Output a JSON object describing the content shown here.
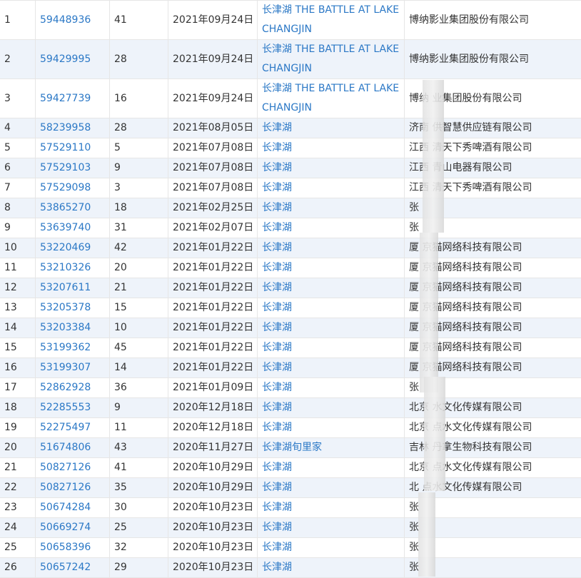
{
  "table": {
    "rows": [
      {
        "idx": "1",
        "reg": "59448936",
        "cls": "41",
        "date": "2021年09月24日",
        "name": "长津湖 THE BATTLE AT LAKE CHANGJIN",
        "owner": "博纳影业集团股份有限公司"
      },
      {
        "idx": "2",
        "reg": "59429995",
        "cls": "28",
        "date": "2021年09月24日",
        "name": "长津湖 THE BATTLE AT LAKE CHANGJIN",
        "owner": "博纳影业集团股份有限公司"
      },
      {
        "idx": "3",
        "reg": "59427739",
        "cls": "16",
        "date": "2021年09月24日",
        "name": "长津湖 THE BATTLE AT LAKE CHANGJIN",
        "owner": "博纳  业集团股份有限公司"
      },
      {
        "idx": "4",
        "reg": "58239958",
        "cls": "28",
        "date": "2021年08月05日",
        "name": "长津湖",
        "owner": "济南  供智慧供应链有限公司"
      },
      {
        "idx": "5",
        "reg": "57529110",
        "cls": "5",
        "date": "2021年07月08日",
        "name": "长津湖",
        "owner": "江西  清天下秀啤酒有限公司"
      },
      {
        "idx": "6",
        "reg": "57529103",
        "cls": "9",
        "date": "2021年07月08日",
        "name": "长津湖",
        "owner": "江西  青山电器有限公司"
      },
      {
        "idx": "7",
        "reg": "57529098",
        "cls": "3",
        "date": "2021年07月08日",
        "name": "长津湖",
        "owner": "江西  清天下秀啤酒有限公司"
      },
      {
        "idx": "8",
        "reg": "53865270",
        "cls": "18",
        "date": "2021年02月25日",
        "name": "长津湖",
        "owner": "张"
      },
      {
        "idx": "9",
        "reg": "53639740",
        "cls": "31",
        "date": "2021年02月07日",
        "name": "长津湖",
        "owner": "张"
      },
      {
        "idx": "10",
        "reg": "53220469",
        "cls": "42",
        "date": "2021年01月22日",
        "name": "长津湖",
        "owner": "厦  京猫网络科技有限公司"
      },
      {
        "idx": "11",
        "reg": "53210326",
        "cls": "20",
        "date": "2021年01月22日",
        "name": "长津湖",
        "owner": "厦  京猫网络科技有限公司"
      },
      {
        "idx": "12",
        "reg": "53207611",
        "cls": "21",
        "date": "2021年01月22日",
        "name": "长津湖",
        "owner": "厦  京猫网络科技有限公司"
      },
      {
        "idx": "13",
        "reg": "53205378",
        "cls": "15",
        "date": "2021年01月22日",
        "name": "长津湖",
        "owner": "厦  京猫网络科技有限公司"
      },
      {
        "idx": "14",
        "reg": "53203384",
        "cls": "10",
        "date": "2021年01月22日",
        "name": "长津湖",
        "owner": "厦  京猫网络科技有限公司"
      },
      {
        "idx": "15",
        "reg": "53199362",
        "cls": "45",
        "date": "2021年01月22日",
        "name": "长津湖",
        "owner": "厦  京猫网络科技有限公司"
      },
      {
        "idx": "16",
        "reg": "53199307",
        "cls": "14",
        "date": "2021年01月22日",
        "name": "长津湖",
        "owner": "厦  京猫网络科技有限公司"
      },
      {
        "idx": "17",
        "reg": "52862928",
        "cls": "36",
        "date": "2021年01月09日",
        "name": "长津湖",
        "owner": "张"
      },
      {
        "idx": "18",
        "reg": "52285553",
        "cls": "9",
        "date": "2020年12月18日",
        "name": "长津湖",
        "owner": "北京  水文化传媒有限公司"
      },
      {
        "idx": "19",
        "reg": "52275497",
        "cls": "11",
        "date": "2020年12月18日",
        "name": "长津湖",
        "owner": "北京  点水文化传媒有限公司"
      },
      {
        "idx": "20",
        "reg": "51674806",
        "cls": "43",
        "date": "2020年11月27日",
        "name": "长津湖旬里家",
        "owner": "吉林  丹拿生物科技有限公司"
      },
      {
        "idx": "21",
        "reg": "50827126",
        "cls": "41",
        "date": "2020年10月29日",
        "name": "长津湖",
        "owner": "北京  点水文化传媒有限公司"
      },
      {
        "idx": "22",
        "reg": "50827126",
        "cls": "35",
        "date": "2020年10月29日",
        "name": "长津湖",
        "owner": "北  点水文化传媒有限公司"
      },
      {
        "idx": "23",
        "reg": "50674284",
        "cls": "30",
        "date": "2020年10月23日",
        "name": "长津湖",
        "owner": "张"
      },
      {
        "idx": "24",
        "reg": "50669274",
        "cls": "25",
        "date": "2020年10月23日",
        "name": "长津湖",
        "owner": "张"
      },
      {
        "idx": "25",
        "reg": "50658396",
        "cls": "32",
        "date": "2020年10月23日",
        "name": "长津湖",
        "owner": "张"
      },
      {
        "idx": "26",
        "reg": "50657242",
        "cls": "29",
        "date": "2020年10月23日",
        "name": "长津湖",
        "owner": "张"
      }
    ]
  }
}
